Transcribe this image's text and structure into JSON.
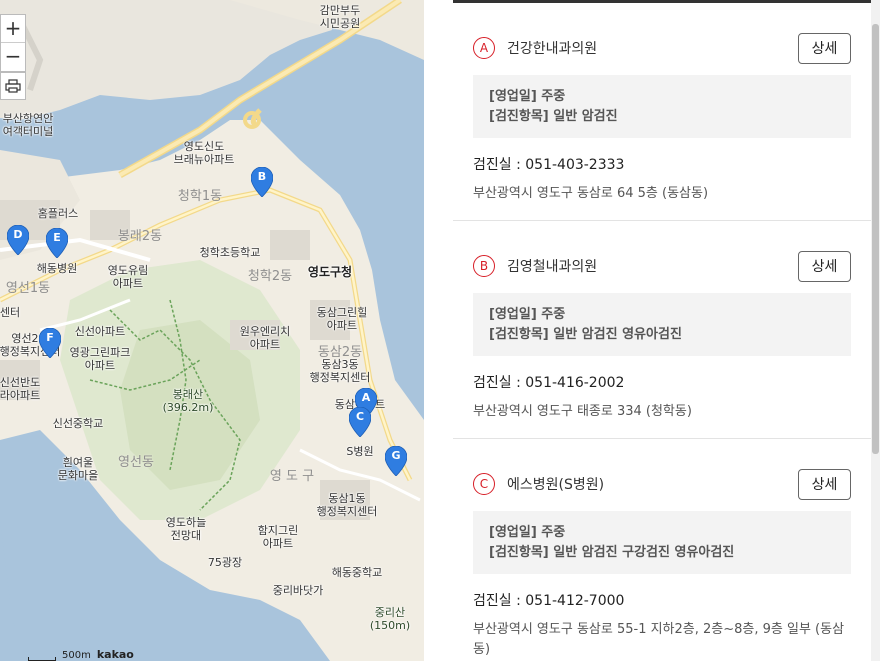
{
  "map": {
    "zoom_in": "+",
    "zoom_out": "−",
    "scale": "500m",
    "brand": "kakao",
    "labels": [
      {
        "text": "감만부두\n시민공원",
        "cls": ""
      },
      {
        "text": "부산항연안\n여객터미널",
        "cls": ""
      },
      {
        "text": "영도신도\n브래뉴아파트",
        "cls": ""
      },
      {
        "text": "청학1동",
        "cls": "district"
      },
      {
        "text": "홈플러스",
        "cls": ""
      },
      {
        "text": "봉래2동",
        "cls": "district"
      },
      {
        "text": "청학초등학교",
        "cls": ""
      },
      {
        "text": "해동병원",
        "cls": ""
      },
      {
        "text": "영도유림\n아파트",
        "cls": ""
      },
      {
        "text": "청학2동",
        "cls": "district"
      },
      {
        "text": "영도구청",
        "cls": "big"
      },
      {
        "text": "영선1동",
        "cls": "district"
      },
      {
        "text": "센터",
        "cls": ""
      },
      {
        "text": "신선아파트",
        "cls": ""
      },
      {
        "text": "원우엔리치\n아파트",
        "cls": ""
      },
      {
        "text": "동삼그린힐\n아파트",
        "cls": ""
      },
      {
        "text": "영선2동\n행정복지센터",
        "cls": ""
      },
      {
        "text": "영광그린파크\n아파트",
        "cls": ""
      },
      {
        "text": "동삼3동\n행정복지센터",
        "cls": ""
      },
      {
        "text": "동삼2동",
        "cls": "district"
      },
      {
        "text": "신선반도\n라아파트",
        "cls": ""
      },
      {
        "text": "봉래산\n(396.2m)",
        "cls": "mtn"
      },
      {
        "text": "신선중학교",
        "cls": ""
      },
      {
        "text": "동삼아파트",
        "cls": ""
      },
      {
        "text": "S병원",
        "cls": ""
      },
      {
        "text": "흰여울\n문화마을",
        "cls": ""
      },
      {
        "text": "영선동",
        "cls": "district"
      },
      {
        "text": "영 도 구",
        "cls": "district"
      },
      {
        "text": "동삼1동\n행정복지센터",
        "cls": ""
      },
      {
        "text": "영도하늘\n전망대",
        "cls": ""
      },
      {
        "text": "함지그린\n아파트",
        "cls": ""
      },
      {
        "text": "해동중학교",
        "cls": ""
      },
      {
        "text": "75광장",
        "cls": ""
      },
      {
        "text": "중리바닷가",
        "cls": ""
      },
      {
        "text": "중리산\n(150m)",
        "cls": "mtn"
      }
    ],
    "markers": [
      {
        "letter": "A",
        "color": "#2f7de1"
      },
      {
        "letter": "B",
        "color": "#2f7de1"
      },
      {
        "letter": "C",
        "color": "#2f7de1"
      },
      {
        "letter": "D",
        "color": "#2f7de1"
      },
      {
        "letter": "E",
        "color": "#2f7de1"
      },
      {
        "letter": "F",
        "color": "#2f7de1"
      },
      {
        "letter": "G",
        "color": "#2f7de1"
      }
    ]
  },
  "clinics": [
    {
      "letter": "A",
      "name": "건강한내과의원",
      "detail_label": "상세",
      "info": [
        "[영업일] 주중",
        "[검진항목] 일반 암검진"
      ],
      "phone": "검진실 :  051-403-2333",
      "address": "부산광역시 영도구 동삼로 64 5층 (동삼동)"
    },
    {
      "letter": "B",
      "name": "김영철내과의원",
      "detail_label": "상세",
      "info": [
        "[영업일] 주중",
        "[검진항목] 일반 암검진 영유아검진"
      ],
      "phone": "검진실 :  051-416-2002",
      "address": "부산광역시 영도구 태종로 334 (청학동)"
    },
    {
      "letter": "C",
      "name": "에스병원(S병원)",
      "detail_label": "상세",
      "info": [
        "[영업일] 주중",
        "[검진항목] 일반 암검진 구강검진 영유아검진"
      ],
      "phone": "검진실 :  051-412-7000",
      "address": "부산광역시 영도구 동삼로 55-1 지하2층, 2층~8층, 9층 일부 (동삼동)"
    }
  ],
  "colors": {
    "accent": "#d71e27",
    "marker": "#2f7de1",
    "sea": "#a9c4dc",
    "land": "#f1ede3"
  }
}
